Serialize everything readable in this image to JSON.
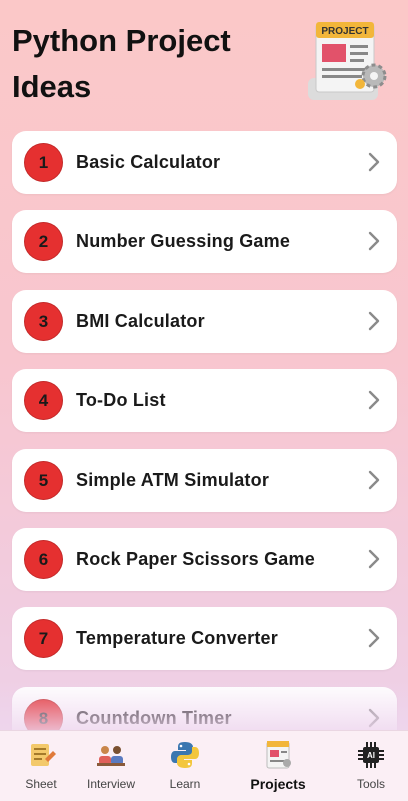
{
  "header": {
    "title": "Python Project Ideas",
    "illustration_text": "PROJECT"
  },
  "projects": [
    {
      "number": "1",
      "label": "Basic Calculator"
    },
    {
      "number": "2",
      "label": "Number Guessing Game"
    },
    {
      "number": "3",
      "label": "BMI Calculator"
    },
    {
      "number": "4",
      "label": "To-Do List"
    },
    {
      "number": "5",
      "label": "Simple ATM Simulator"
    },
    {
      "number": "6",
      "label": "Rock Paper Scissors Game"
    },
    {
      "number": "7",
      "label": "Temperature Converter"
    },
    {
      "number": "8",
      "label": "Countdown Timer"
    }
  ],
  "nav": [
    {
      "label": "Sheet",
      "icon": "sheet-icon",
      "active": false
    },
    {
      "label": "Interview",
      "icon": "interview-icon",
      "active": false
    },
    {
      "label": "Learn",
      "icon": "python-logo-icon",
      "active": false
    },
    {
      "label": "Projects",
      "icon": "projects-icon",
      "active": true
    },
    {
      "label": "Tools",
      "icon": "ai-chip-icon",
      "active": false,
      "icon_text": "AI"
    }
  ],
  "colors": {
    "number_badge": "#e53030",
    "card": "#ffffff",
    "chevron": "#8a8a8a"
  }
}
